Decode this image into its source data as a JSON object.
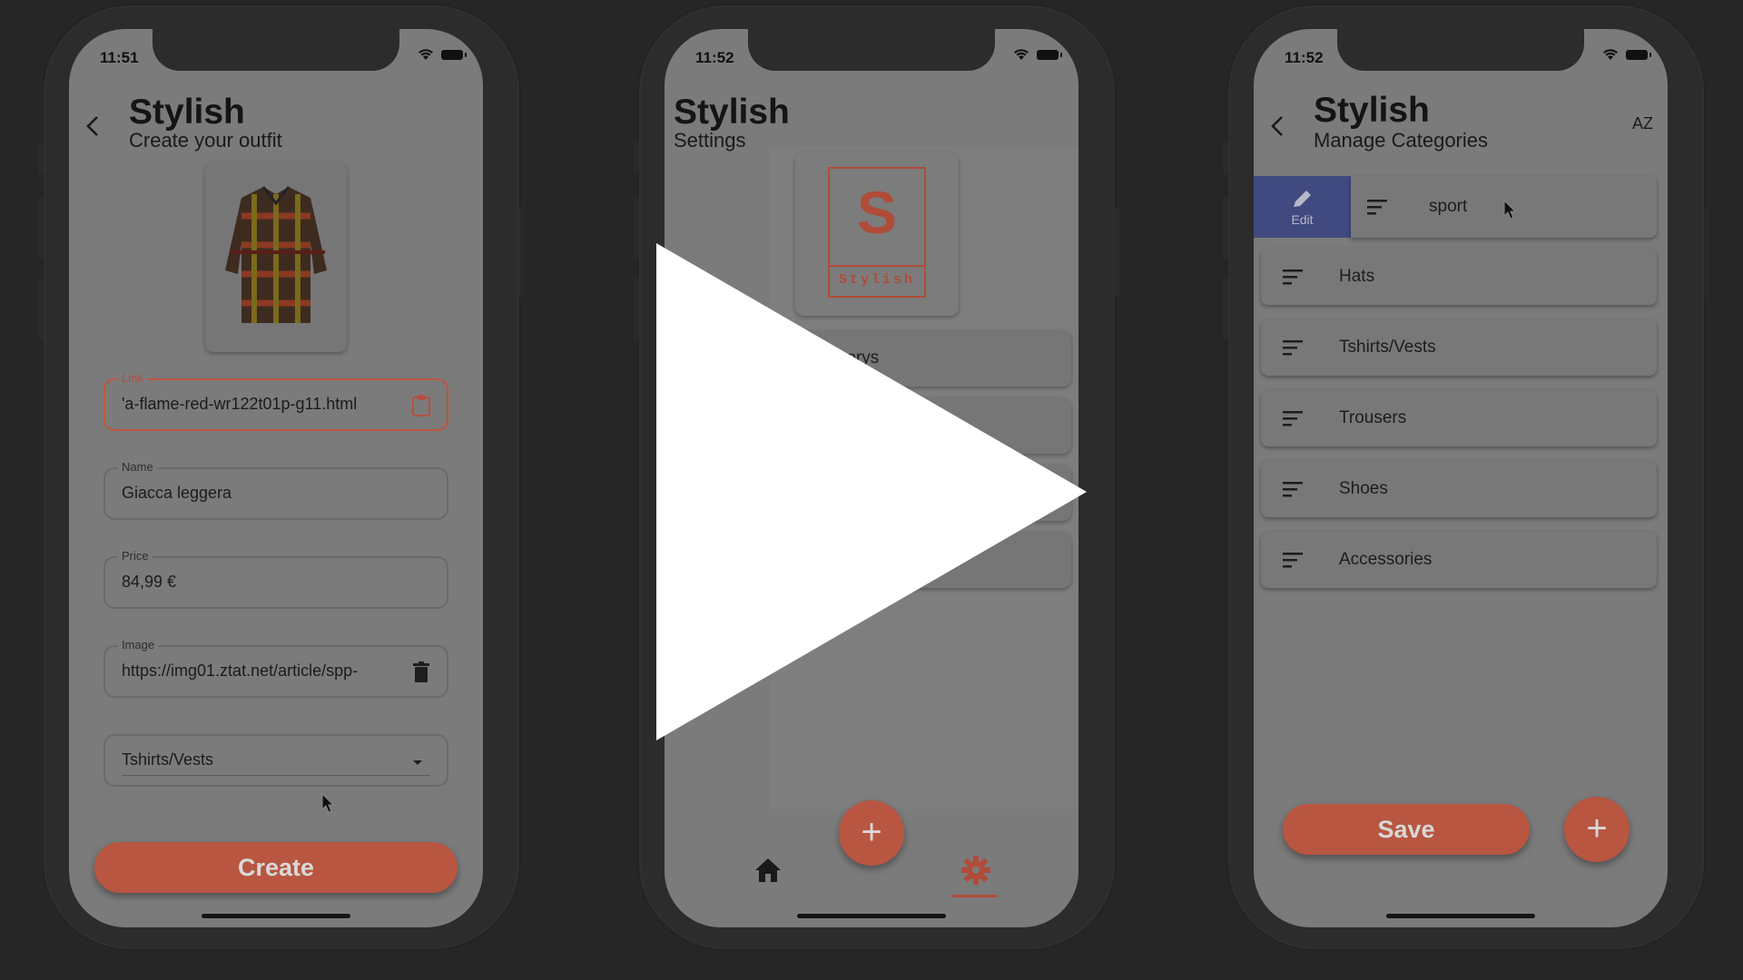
{
  "screen1": {
    "time": "11:51",
    "title": "Stylish",
    "subtitle": "Create your outfit",
    "link_label": "Link",
    "link_value": "'a-flame-red-wr122t01p-g11.html",
    "name_label": "Name",
    "name_value": "Giacca leggera",
    "price_label": "Price",
    "price_value": "84,99 €",
    "image_label": "Image",
    "image_value": "https://img01.ztat.net/article/spp-",
    "category_value": "Tshirts/Vests",
    "create_label": "Create"
  },
  "screen2": {
    "time": "11:52",
    "title": "Stylish",
    "subtitle": "Settings",
    "logo_letter": "S",
    "logo_text": "Stylish",
    "menu_visible_text": "tegorys"
  },
  "screen3": {
    "time": "11:52",
    "title": "Stylish",
    "subtitle": "Manage Categories",
    "sort_label": "AZ",
    "edit_label": "Edit",
    "first_item": "sport",
    "items": [
      "Hats",
      "Tshirts/Vests",
      "Trousers",
      "Shoes",
      "Accessories"
    ],
    "save_label": "Save"
  },
  "colors": {
    "accent": "#b85641",
    "edit_action": "#404a80",
    "overlay_bg": "#262626"
  }
}
